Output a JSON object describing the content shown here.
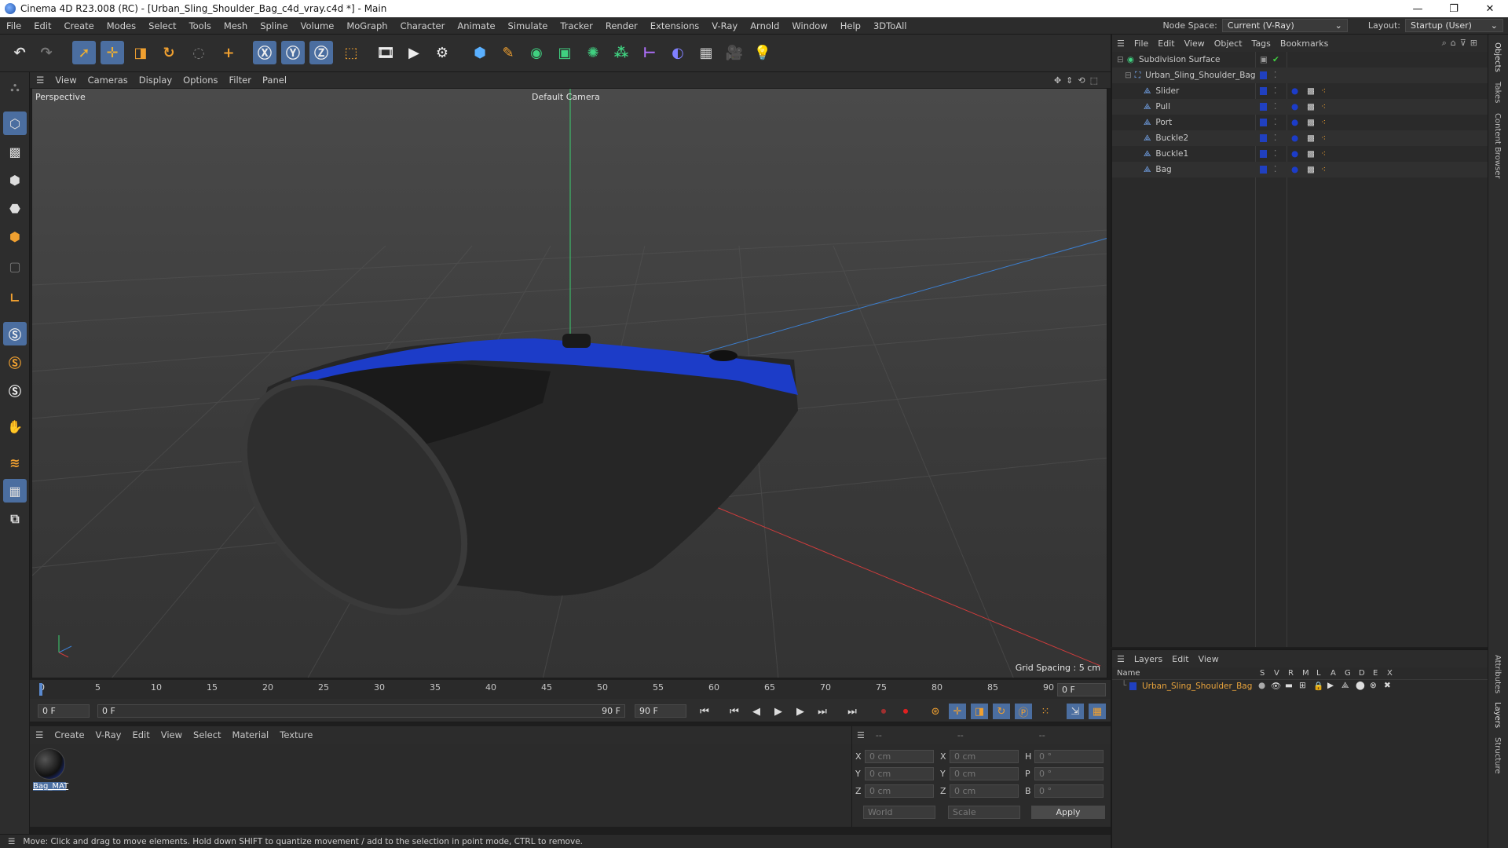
{
  "window": {
    "title": "Cinema 4D R23.008 (RC) - [Urban_Sling_Shoulder_Bag_c4d_vray.c4d *] - Main",
    "minimize": "—",
    "maximize": "❐",
    "close": "✕"
  },
  "menu": {
    "items": [
      "File",
      "Edit",
      "Create",
      "Modes",
      "Select",
      "Tools",
      "Mesh",
      "Spline",
      "Volume",
      "MoGraph",
      "Character",
      "Animate",
      "Simulate",
      "Tracker",
      "Render",
      "Extensions",
      "V-Ray",
      "Arnold",
      "Window",
      "Help",
      "3DToAll"
    ],
    "node_space_label": "Node Space:",
    "node_space_value": "Current (V-Ray)",
    "layout_label": "Layout:",
    "layout_value": "Startup (User)"
  },
  "viewport": {
    "menu": [
      "View",
      "Cameras",
      "Display",
      "Options",
      "Filter",
      "Panel"
    ],
    "name": "Perspective",
    "camera": "Default Camera",
    "grid_spacing": "Grid Spacing : 5 cm"
  },
  "timeline": {
    "ticks": [
      "0",
      "5",
      "10",
      "15",
      "20",
      "25",
      "30",
      "35",
      "40",
      "45",
      "50",
      "55",
      "60",
      "65",
      "70",
      "75",
      "80",
      "85",
      "90"
    ],
    "current_frame": "0 F",
    "start": "0 F",
    "range_start": "0 F",
    "range_end": "90 F",
    "end": "90 F"
  },
  "materials": {
    "menu": [
      "Create",
      "V-Ray",
      "Edit",
      "View",
      "Select",
      "Material",
      "Texture"
    ],
    "items": [
      {
        "name": "Bag_MAT"
      }
    ]
  },
  "coords": {
    "headers": [
      "--",
      "--",
      "--"
    ],
    "rows": [
      {
        "a": "X",
        "av": "0 cm",
        "b": "X",
        "bv": "0 cm",
        "c": "H",
        "cv": "0 °"
      },
      {
        "a": "Y",
        "av": "0 cm",
        "b": "Y",
        "bv": "0 cm",
        "c": "P",
        "cv": "0 °"
      },
      {
        "a": "Z",
        "av": "0 cm",
        "b": "Z",
        "bv": "0 cm",
        "c": "B",
        "cv": "0 °"
      }
    ],
    "space": "World",
    "mode": "Scale",
    "apply": "Apply"
  },
  "status": "Move: Click and drag to move elements. Hold down SHIFT to quantize movement / add to the selection in point mode, CTRL to remove.",
  "objects": {
    "menu": [
      "File",
      "Edit",
      "View",
      "Object",
      "Tags",
      "Bookmarks"
    ],
    "items": [
      {
        "name": "Subdivision Surface",
        "level": 0
      },
      {
        "name": "Urban_Sling_Shoulder_Bag",
        "level": 1
      },
      {
        "name": "Slider",
        "level": 2
      },
      {
        "name": "Pull",
        "level": 2
      },
      {
        "name": "Port",
        "level": 2
      },
      {
        "name": "Buckle2",
        "level": 2
      },
      {
        "name": "Buckle1",
        "level": 2
      },
      {
        "name": "Bag",
        "level": 2
      }
    ]
  },
  "layers": {
    "menu": [
      "Layers",
      "Edit",
      "View"
    ],
    "header_name": "Name",
    "columns": [
      "S",
      "V",
      "R",
      "M",
      "L",
      "A",
      "G",
      "D",
      "E",
      "X"
    ],
    "items": [
      {
        "name": "Urban_Sling_Shoulder_Bag",
        "color": "#1c3cc8"
      }
    ]
  },
  "side_tabs": [
    "Objects",
    "Takes",
    "Content Browser",
    "Attributes",
    "Layers",
    "Structure"
  ],
  "colors": {
    "accent": "#4b6ea0",
    "bag_blue": "#1c3cc8",
    "layer_text": "#e8a33c"
  }
}
